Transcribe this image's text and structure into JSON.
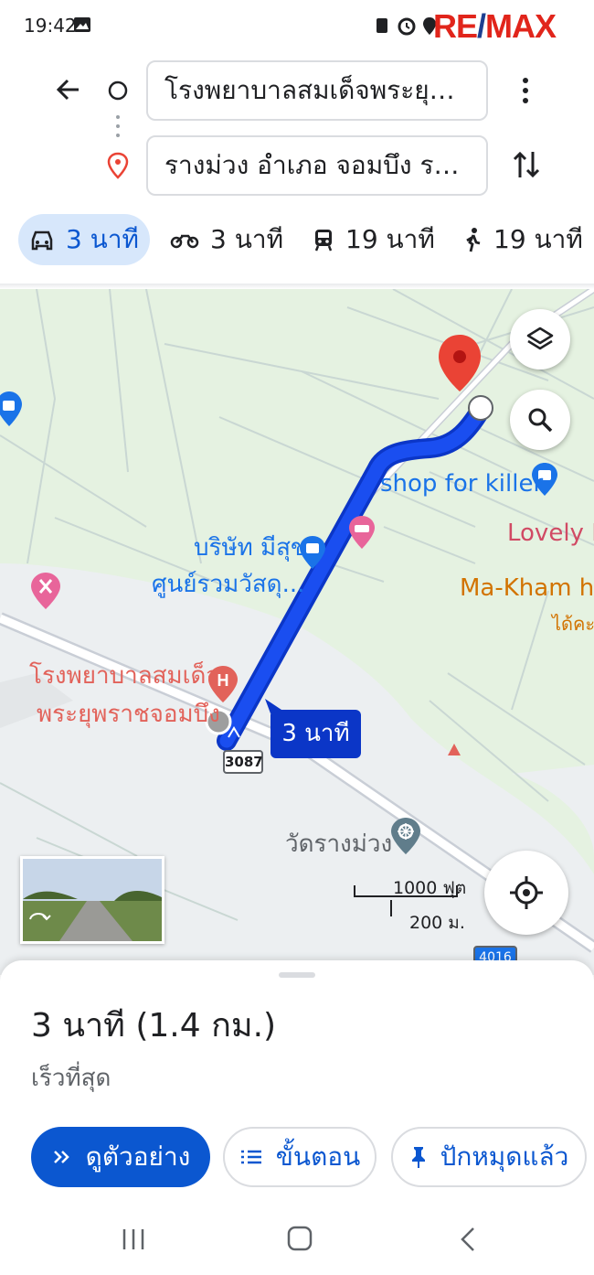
{
  "status_bar": {
    "time": "19:42",
    "watermark": {
      "re": "RE",
      "slash": "/",
      "max": "MAX"
    }
  },
  "route": {
    "origin": "โรงพยาบาลสมเด็จพระยุพร...",
    "destination": "รางม่วง อำเภอ จอมบึง ราช..."
  },
  "modes": [
    {
      "icon": "car-icon",
      "label": "3 นาที",
      "active": true
    },
    {
      "icon": "motorcycle-icon",
      "label": "3 นาที",
      "active": false
    },
    {
      "icon": "transit-icon",
      "label": "19 นาที",
      "active": false
    },
    {
      "icon": "walk-icon",
      "label": "19 นาที",
      "active": false
    }
  ],
  "map": {
    "poi_shop": "shop for killer",
    "poi_lovely": "Lovely La",
    "poi_makham": "Ma-Kham hom",
    "poi_makham_sub": "ได้คะแ",
    "poi_company_1": "บริษัท มีสุข",
    "poi_company_2": "ศูนย์รวมวัสดุ...",
    "hospital_1": "โรงพยาบาลสมเด็จ",
    "hospital_2": "พระยุพราชจอมบึง",
    "route_time": "3 นาที",
    "road_shield": "3087",
    "road_shield_2": "4016",
    "temple": "วัดรางม่วง",
    "scale_ft": "1000 ฟุต",
    "scale_m": "200 ม.",
    "colors": {
      "route": "#1a4ef0",
      "route_border": "#0b36c7",
      "pin": "#ea4335",
      "hospital": "#e2625a",
      "poi_blue": "#1a73e8"
    }
  },
  "sheet": {
    "summary": "3 นาที (1.4 กม.)",
    "subtitle": "เร็วที่สุด",
    "buttons": {
      "preview": "ดูตัวอย่าง",
      "steps": "ขั้นตอน",
      "pinned": "ปักหมุดแล้ว"
    }
  }
}
